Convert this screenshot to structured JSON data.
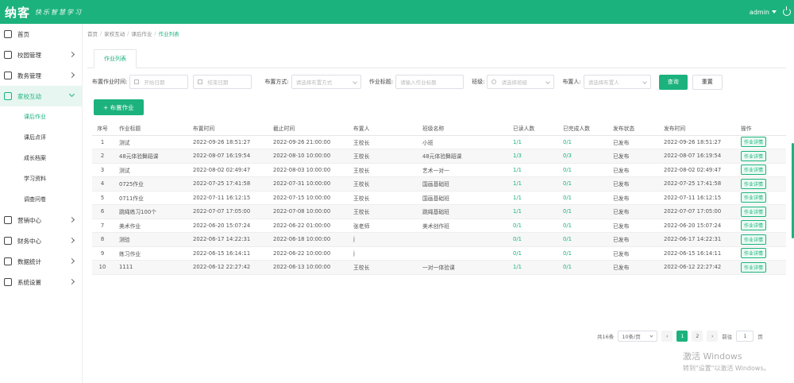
{
  "header": {
    "logo": "纳客",
    "slogan": "快乐智慧学习",
    "user": "admin"
  },
  "sidebar": {
    "items": [
      {
        "label": "首页",
        "icon": "home-icon"
      },
      {
        "label": "校园管理",
        "icon": "school-icon"
      },
      {
        "label": "教务管理",
        "icon": "book-icon"
      },
      {
        "label": "家校互动",
        "icon": "interaction-icon",
        "open": true,
        "children": [
          {
            "label": "课后作业",
            "active": true
          },
          {
            "label": "课后点评"
          },
          {
            "label": "成长档案"
          },
          {
            "label": "学习资料"
          },
          {
            "label": "调查问卷"
          }
        ]
      },
      {
        "label": "营销中心",
        "icon": "marketing-icon"
      },
      {
        "label": "财务中心",
        "icon": "finance-icon"
      },
      {
        "label": "数据统计",
        "icon": "stats-icon"
      },
      {
        "label": "系统设置",
        "icon": "settings-icon"
      }
    ]
  },
  "breadcrumb": [
    "首页",
    "家校互动",
    "课后作业",
    "作业列表"
  ],
  "tab": "作业列表",
  "filters": {
    "time_label": "布置作业时间:",
    "start_placeholder": "开始日期",
    "end_placeholder": "结束日期",
    "method_label": "布置方式:",
    "method_placeholder": "请选择布置方式",
    "title_label": "作业标题:",
    "title_placeholder": "请输入作业标题",
    "class_label": "班级:",
    "class_placeholder": "请选择班级",
    "publisher_label": "布置人:",
    "publisher_placeholder": "请选择布置人",
    "query": "查询",
    "reset": "重置"
  },
  "add_button": "+ 布置作业",
  "table": {
    "headers": [
      "序号",
      "作业标题",
      "布置时间",
      "截止时间",
      "布置人",
      "班级名称",
      "已读人数",
      "已完成人数",
      "发布状态",
      "发布时间",
      "操作"
    ],
    "rows": [
      [
        "1",
        "测试",
        "2022-09-26 18:51:27",
        "2022-09-26 21:00:00",
        "王校长",
        "小班",
        "1/1",
        "0/1",
        "已发布",
        "2022-09-26 18:51:27",
        "作业详情"
      ],
      [
        "2",
        "48元体验舞蹈课",
        "2022-08-07 16:19:54",
        "2022-08-10 10:00:00",
        "王校长",
        "48元体验舞蹈课",
        "1/3",
        "0/3",
        "已发布",
        "2022-08-07 16:19:54",
        "作业详情"
      ],
      [
        "3",
        "测试",
        "2022-08-02 02:49:47",
        "2022-08-03 10:00:00",
        "王校长",
        "艺术一对一",
        "1/1",
        "0/1",
        "已发布",
        "2022-08-02 02:49:47",
        "作业详情"
      ],
      [
        "4",
        "0725作业",
        "2022-07-25 17:41:58",
        "2022-07-31 10:00:00",
        "王校长",
        "国画基础班",
        "1/1",
        "0/1",
        "已发布",
        "2022-07-25 17:41:58",
        "作业详情"
      ],
      [
        "5",
        "0711作业",
        "2022-07-11 16:12:15",
        "2022-07-15 10:00:00",
        "王校长",
        "国画基础班",
        "1/1",
        "0/1",
        "已发布",
        "2022-07-11 16:12:15",
        "作业详情"
      ],
      [
        "6",
        "跳绳练习100个",
        "2022-07-07 17:05:00",
        "2022-07-08 10:00:00",
        "王校长",
        "跳绳基础班",
        "1/1",
        "0/1",
        "已发布",
        "2022-07-07 17:05:00",
        "作业详情"
      ],
      [
        "7",
        "美术作业",
        "2022-06-20 15:07:24",
        "2022-06-22 01:00:00",
        "张老师",
        "美术创作班",
        "0/1",
        "0/1",
        "已发布",
        "2022-06-20 15:07:24",
        "作业详情"
      ],
      [
        "8",
        "测验",
        "2022-06-17 14:22:31",
        "2022-06-18 10:00:00",
        "j",
        "",
        "0/1",
        "0/1",
        "已发布",
        "2022-06-17 14:22:31",
        "作业详情"
      ],
      [
        "9",
        "练习作业",
        "2022-06-15 16:14:11",
        "2022-06-22 10:00:00",
        "j",
        "",
        "0/1",
        "0/1",
        "已发布",
        "2022-06-15 16:14:11",
        "作业详情"
      ],
      [
        "10",
        "1111",
        "2022-06-12 22:27:42",
        "2022-06-13 10:00:00",
        "王校长",
        "一对一体验课",
        "1/1",
        "0/1",
        "已发布",
        "2022-06-12 22:27:42",
        "作业详情"
      ]
    ]
  },
  "pagination": {
    "total": "共16条",
    "page_size": "10条/页",
    "prev": "‹",
    "pages": [
      "1",
      "2"
    ],
    "next": "›",
    "goto_label": "前往",
    "goto_value": "1",
    "goto_suffix": "页"
  },
  "watermark": {
    "line1": "激活 Windows",
    "line2": "转到\"设置\"以激活 Windows。"
  }
}
